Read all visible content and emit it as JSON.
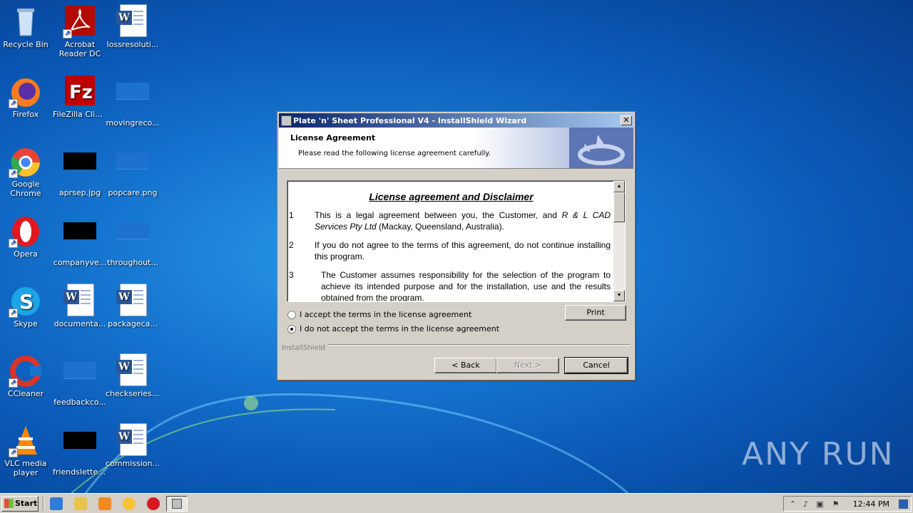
{
  "desktop": {
    "icons": [
      {
        "label": "Recycle Bin"
      },
      {
        "label": "Acrobat Reader DC"
      },
      {
        "label": "lossresoluti..."
      },
      {
        "label": "Firefox"
      },
      {
        "label": "FileZilla Client"
      },
      {
        "label": "movingreco..."
      },
      {
        "label": "Google Chrome"
      },
      {
        "label": "aprsep.jpg"
      },
      {
        "label": "popcare.png"
      },
      {
        "label": "Opera"
      },
      {
        "label": "companyve..."
      },
      {
        "label": "throughout..."
      },
      {
        "label": "Skype"
      },
      {
        "label": "documenta..."
      },
      {
        "label": "packageca..."
      },
      {
        "label": "CCleaner"
      },
      {
        "label": "feedbackco..."
      },
      {
        "label": "checkseries.rtf"
      },
      {
        "label": "VLC media player"
      },
      {
        "label": "friendsletter..."
      },
      {
        "label": "commission..."
      }
    ],
    "watermark": "ANY RUN"
  },
  "dialog": {
    "title": "Plate 'n' Sheet Professional V4 - InstallShield Wizard",
    "close_label": "✕",
    "heading": "License Agreement",
    "subheading": "Please read the following license agreement carefully.",
    "license": {
      "title": "License agreement and Disclaimer",
      "clauses": [
        {
          "num": "1",
          "text_a": "This is a legal agreement between you, the Customer, and ",
          "text_company": "R & L CAD Services Pty Ltd",
          "text_b": " (Mackay, Queensland, Australia)."
        },
        {
          "num": "2",
          "text": "If you do not agree to the terms of this agreement, do not continue installing this program."
        },
        {
          "num": "3",
          "text": "The Customer assumes responsibility for the selection of the program to achieve its intended purpose and for the installation, use and the results obtained from the program."
        }
      ]
    },
    "radio_accept": "I accept the terms in the license agreement",
    "radio_decline": "I do not accept the terms in the license agreement",
    "selected": "decline",
    "print_label": "Print",
    "brand": "InstallShield",
    "back_label": "< Back",
    "next_label": "Next >",
    "cancel_label": "Cancel"
  },
  "taskbar": {
    "start_label": "Start",
    "clock": "12:44 PM"
  }
}
